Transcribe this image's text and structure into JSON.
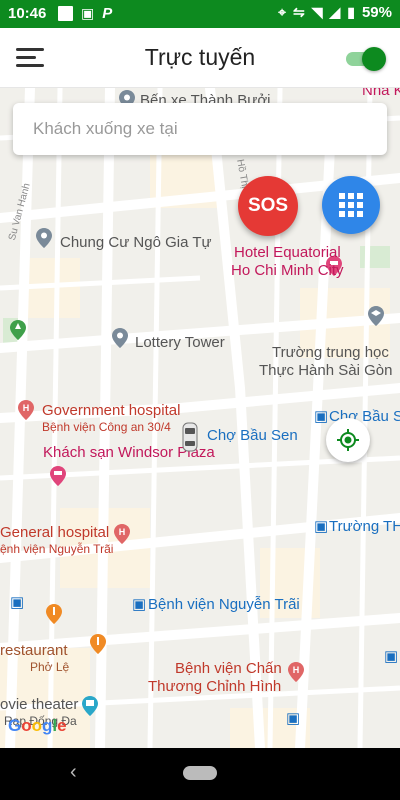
{
  "status_bar": {
    "time": "10:46",
    "battery": "59%",
    "app_icon_letter": "P"
  },
  "header": {
    "title": "Trực tuyến",
    "online_toggle": true
  },
  "search": {
    "placeholder": "Khách xuống xe tại"
  },
  "buttons": {
    "sos": "SOS"
  },
  "map": {
    "labels": {
      "ben_xe": "Bến xe Thành Bưởi",
      "nha_k": "Nhà K",
      "chung_cu": "Chung Cư Ngô Gia Tự",
      "hotel_1": "Hotel Equatorial",
      "hotel_2": "Ho Chi Minh City",
      "lottery": "Lottery Tower",
      "truong_1": "Trường trung học",
      "truong_2": "Thực Hành Sài Gòn",
      "gov_hosp": "Government hospital",
      "gov_hosp_sub": "Bệnh viện Công an 30/4",
      "cho_ben_thanh": "Chợ Bầu S",
      "cho_bau_sen": "Chợ Bầu Sen",
      "windsor": "Khách sạn Windsor Plaza",
      "gen_hosp": "General hospital",
      "gen_hosp_sub": "ệnh viện Nguyễn Trãi",
      "truong_th": "Trường TH",
      "bv_nguyen_trai": "Bệnh viện Nguyễn Trãi",
      "restaurant": "restaurant",
      "pho_le": "Phở Lệ",
      "bv_chan_1": "Bệnh viện Chấn",
      "bv_chan_2": "Thương Chỉnh Hình",
      "movie": "ovie theater",
      "movie_sub": "Rạp Đống Đa",
      "street_su_van_hanh": "Su Van Hanh",
      "street_ho_thi_ky": "Hồ Thị Kỷ"
    },
    "attribution": "Google"
  },
  "colors": {
    "primary_green": "#0d8a1f",
    "sos_red": "#e53935",
    "grid_blue": "#2f86e8"
  },
  "icons": {
    "menu": "hamburger-icon",
    "grid": "apps-grid-icon",
    "locate": "my-location-icon",
    "car": "car-icon"
  }
}
